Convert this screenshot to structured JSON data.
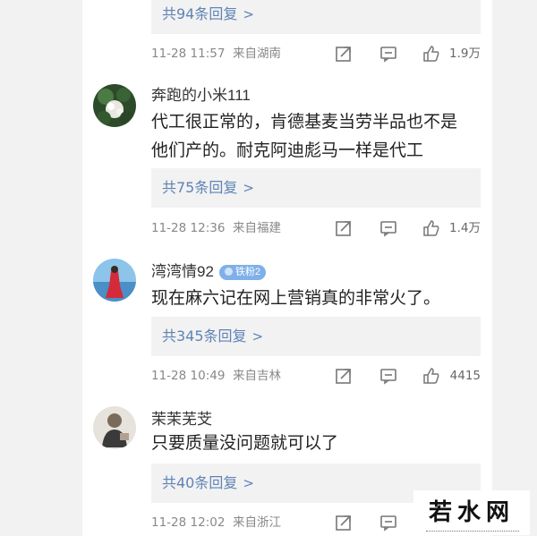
{
  "comments": [
    {
      "username": "",
      "text": "",
      "reply_label": "共94条回复",
      "time": "11-28 11:57",
      "source": "来自湖南",
      "like_count": "1.9万"
    },
    {
      "username": "奔跑的小米111",
      "text": "代工很正常的，肯德基麦当劳半品也不是他们产的。耐克阿迪彪马一样是代工",
      "reply_label": "共75条回复",
      "time": "11-28 12:36",
      "source": "来自福建",
      "like_count": "1.4万"
    },
    {
      "username": "湾湾情92",
      "badge": "铁粉2",
      "text": "现在麻六记在网上营销真的非常火了。",
      "reply_label": "共345条回复",
      "time": "11-28 10:49",
      "source": "来自吉林",
      "like_count": "4415"
    },
    {
      "username": "茉茉芜芠",
      "text": "只要质量没问题就可以了",
      "reply_label": "共40条回复",
      "time": "11-28 12:02",
      "source": "来自浙江",
      "like_count": ""
    }
  ],
  "watermark": "若水网",
  "icons": {
    "share": "share-icon",
    "comment": "comment-icon",
    "like": "thumbs-up-icon",
    "chevron": "chevron-right-icon"
  },
  "colors": {
    "link_blue": "#5f83b5",
    "badge_blue": "#7fb0e8"
  }
}
